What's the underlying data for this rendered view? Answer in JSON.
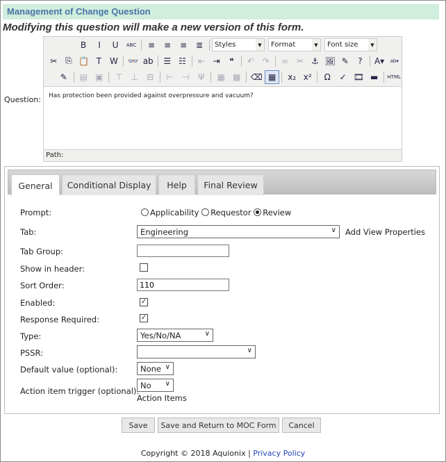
{
  "header": {
    "title": "Management of Change Question",
    "warning": "Modifying this question will make a new version of this form."
  },
  "question": {
    "label": "Question:",
    "text": "Has protection been provided against overpressure and vacuum?",
    "path_label": "Path:"
  },
  "toolbar": {
    "row1": [
      {
        "icon": "bold-icon",
        "g": "B"
      },
      {
        "icon": "italic-icon",
        "g": "I"
      },
      {
        "icon": "underline-icon",
        "g": "U"
      },
      {
        "icon": "strikethrough-icon",
        "g": "ABC"
      },
      "|",
      {
        "icon": "align-left-icon",
        "g": "≡"
      },
      {
        "icon": "align-center-icon",
        "g": "≡"
      },
      {
        "icon": "align-right-icon",
        "g": "≡"
      },
      {
        "icon": "justify-icon",
        "g": "≣"
      },
      "|"
    ],
    "combos": [
      {
        "label": "Styles"
      },
      {
        "label": "Format"
      },
      {
        "label": "Font size"
      }
    ],
    "row2": [
      {
        "icon": "cut-icon",
        "g": "✂"
      },
      {
        "icon": "copy-icon",
        "g": "⎘"
      },
      {
        "icon": "paste-icon",
        "g": "📋"
      },
      {
        "icon": "paste-text-icon",
        "g": "T"
      },
      {
        "icon": "paste-word-icon",
        "g": "W"
      },
      "|",
      {
        "icon": "find-icon",
        "g": "👓"
      },
      {
        "icon": "replace-icon",
        "g": "ab"
      },
      "|",
      {
        "icon": "bullet-list-icon",
        "g": "☰"
      },
      {
        "icon": "numbered-list-icon",
        "g": "☷"
      },
      "|",
      {
        "icon": "outdent-icon",
        "g": "⇤",
        "dis": true
      },
      {
        "icon": "indent-icon",
        "g": "⇥"
      },
      {
        "icon": "blockquote-icon",
        "g": "❝"
      },
      "|",
      {
        "icon": "undo-icon",
        "g": "↶",
        "dis": true
      },
      {
        "icon": "redo-icon",
        "g": "↷",
        "dis": true
      },
      "|",
      {
        "icon": "link-icon",
        "g": "∞",
        "dis": true
      },
      {
        "icon": "unlink-icon",
        "g": "✂",
        "dis": true
      },
      {
        "icon": "anchor-icon",
        "g": "⚓"
      },
      {
        "icon": "image-icon",
        "g": "🖼"
      },
      {
        "icon": "cleanup-icon",
        "g": "✎"
      },
      {
        "icon": "help-icon",
        "g": "?"
      },
      "|",
      {
        "icon": "text-color-icon",
        "g": "A▾"
      },
      {
        "icon": "highlight-color-icon",
        "g": "ab▾"
      }
    ],
    "row3": [
      {
        "icon": "edit-source-icon",
        "g": "✎"
      },
      "|",
      {
        "icon": "table-row-props-icon",
        "g": "▤",
        "dis": true
      },
      {
        "icon": "table-cell-props-icon",
        "g": "▣",
        "dis": true
      },
      "|",
      {
        "icon": "insert-row-before-icon",
        "g": "⊤",
        "dis": true
      },
      {
        "icon": "insert-row-after-icon",
        "g": "⊥",
        "dis": true
      },
      {
        "icon": "delete-row-icon",
        "g": "⊟",
        "dis": true
      },
      "|",
      {
        "icon": "insert-col-before-icon",
        "g": "⊢",
        "dis": true
      },
      {
        "icon": "insert-col-after-icon",
        "g": "⊣",
        "dis": true
      },
      {
        "icon": "delete-col-icon",
        "g": "Ψ",
        "dis": true
      },
      "|",
      {
        "icon": "split-cells-icon",
        "g": "▦",
        "dis": true
      },
      {
        "icon": "merge-cells-icon",
        "g": "▩",
        "dis": true
      },
      "|",
      {
        "icon": "remove-format-icon",
        "g": "⌫"
      },
      {
        "icon": "table-icon",
        "g": "▦",
        "act": true
      },
      "|",
      {
        "icon": "subscript-icon",
        "g": "x₂"
      },
      {
        "icon": "superscript-icon",
        "g": "x²"
      },
      "|",
      {
        "icon": "special-char-icon",
        "g": "Ω"
      },
      {
        "icon": "spellcheck-icon",
        "g": "✓"
      },
      {
        "icon": "media-icon",
        "g": "🎞"
      },
      {
        "icon": "horizontal-rule-icon",
        "g": "▬"
      },
      "|",
      {
        "icon": "html-icon",
        "g": "HTML"
      }
    ]
  },
  "tabs": [
    {
      "label": "General",
      "active": true
    },
    {
      "label": "Conditional Display"
    },
    {
      "label": "Help"
    },
    {
      "label": "Final Review"
    }
  ],
  "form": {
    "prompt": {
      "label": "Prompt:",
      "options": [
        "Applicability",
        "Requestor",
        "Review"
      ],
      "selected": "Review"
    },
    "tab": {
      "label": "Tab:",
      "value": "Engineering",
      "link": "Add View Properties"
    },
    "tab_group": {
      "label": "Tab Group:",
      "value": ""
    },
    "show_in_header": {
      "label": "Show in header:",
      "checked": false
    },
    "sort_order": {
      "label": "Sort Order:",
      "value": "110"
    },
    "enabled": {
      "label": "Enabled:",
      "checked": true
    },
    "response_required": {
      "label": "Response Required:",
      "checked": true
    },
    "type": {
      "label": "Type:",
      "value": "Yes/No/NA"
    },
    "pssr": {
      "label": "PSSR:",
      "value": ""
    },
    "default_value": {
      "label": "Default value (optional):",
      "value": "None"
    },
    "action_item_trigger": {
      "label": "Action item trigger (optional):",
      "value": "No",
      "note": "Action Items"
    }
  },
  "buttons": {
    "save": "Save",
    "save_return": "Save and Return to MOC Form",
    "cancel": "Cancel"
  },
  "footer": {
    "copyright": "Copyright © 2018 Aquionix | ",
    "link": "Privacy Policy"
  }
}
